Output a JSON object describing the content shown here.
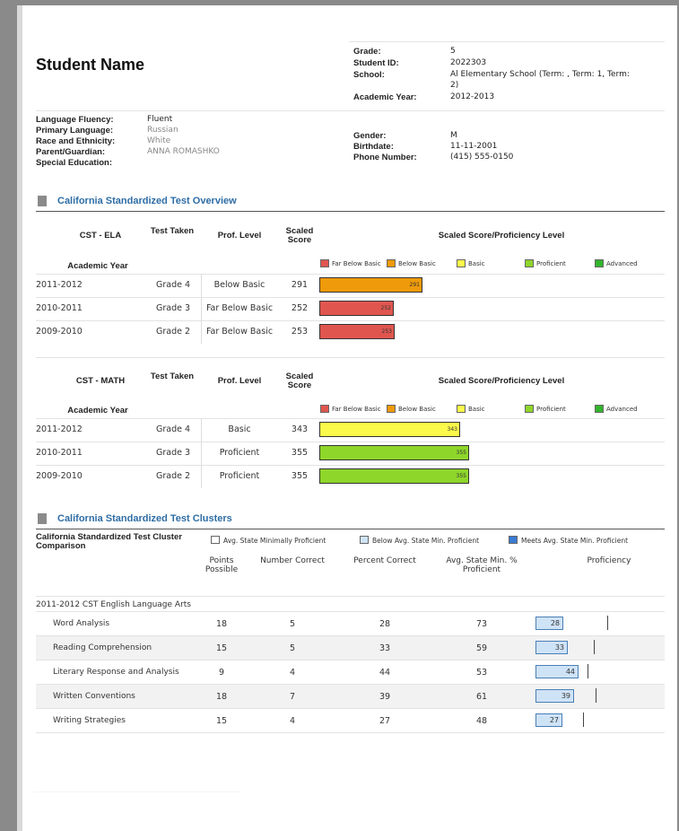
{
  "student": {
    "name_label": "Student Name",
    "grade_label": "Grade:",
    "grade": "5",
    "id_label": "Student ID:",
    "id": "2022303",
    "school_label": "School:",
    "school_line1": "Al     Elementary School (Term: , Term: 1, Term:",
    "school_line2": "2)",
    "year_label": "Academic Year:",
    "year": "2012-2013",
    "fluency_label": "Language Fluency:",
    "fluency": "Fluent",
    "primary_lang_label": "Primary Language:",
    "primary_lang": "Russian",
    "race_label": "Race and Ethnicity:",
    "race": "White",
    "parent_label": "Parent/Guardian:",
    "parent": "ANNA ROMASHKO",
    "sped_label": "Special Education:",
    "gender_label": "Gender:",
    "gender": "M",
    "birth_label": "Birthdate:",
    "birth": "11-11-2001",
    "phone_label": "Phone Number:",
    "phone": "(415) 555-0150"
  },
  "overview": {
    "title": "California Standardized Test Overview",
    "legend": [
      {
        "label": "Far Below Basic",
        "color": "#e0564f"
      },
      {
        "label": "Below Basic",
        "color": "#ee9a0a"
      },
      {
        "label": "Basic",
        "color": "#fbf94a"
      },
      {
        "label": "Proficient",
        "color": "#8fd62b"
      },
      {
        "label": "Advanced",
        "color": "#33b52d"
      }
    ],
    "col_test_taken": "Test Taken",
    "col_prof": "Prof. Level",
    "col_scaled": "Scaled Score",
    "col_chart": "Scaled Score/Proficiency Level",
    "col_year": "Academic Year",
    "ela": {
      "title": "CST - ELA",
      "rows": [
        {
          "year": "2011-2012",
          "grade": "Grade 4",
          "level": "Below Basic",
          "score": "291"
        },
        {
          "year": "2010-2011",
          "grade": "Grade 3",
          "level": "Far Below Basic",
          "score": "252"
        },
        {
          "year": "2009-2010",
          "grade": "Grade 2",
          "level": "Far Below Basic",
          "score": "253"
        }
      ]
    },
    "math": {
      "title": "CST - MATH",
      "rows": [
        {
          "year": "2011-2012",
          "grade": "Grade 4",
          "level": "Basic",
          "score": "343"
        },
        {
          "year": "2010-2011",
          "grade": "Grade 3",
          "level": "Proficient",
          "score": "355"
        },
        {
          "year": "2009-2010",
          "grade": "Grade 2",
          "level": "Proficient",
          "score": "355"
        }
      ]
    }
  },
  "clusters": {
    "title": "California Standardized Test Clusters",
    "comparison_label": "California Standardized Test Cluster Comparison",
    "legend": [
      {
        "label": "Avg. State Minimally Proficient",
        "color": "#ffffff"
      },
      {
        "label": "Below Avg. State Min. Proficient",
        "color": "#cfe3f7"
      },
      {
        "label": "Meets Avg. State Min. Proficient",
        "color": "#3a7bd5"
      }
    ],
    "col_points": "Points Possible",
    "col_correct": "Number Correct",
    "col_percent": "Percent Correct",
    "col_state": "Avg. State Min. % Proficient",
    "col_prof": "Proficiency",
    "group_label": "2011-2012 CST English Language Arts",
    "rows": [
      {
        "name": "Word Analysis",
        "points": "18",
        "correct": "5",
        "percent": "28",
        "state": "73"
      },
      {
        "name": "Reading Comprehension",
        "points": "15",
        "correct": "5",
        "percent": "33",
        "state": "59"
      },
      {
        "name": "Literary Response and Analysis",
        "points": "9",
        "correct": "4",
        "percent": "44",
        "state": "53"
      },
      {
        "name": "Written Conventions",
        "points": "18",
        "correct": "7",
        "percent": "39",
        "state": "61"
      },
      {
        "name": "Writing Strategies",
        "points": "15",
        "correct": "4",
        "percent": "27",
        "state": "48"
      }
    ]
  }
}
